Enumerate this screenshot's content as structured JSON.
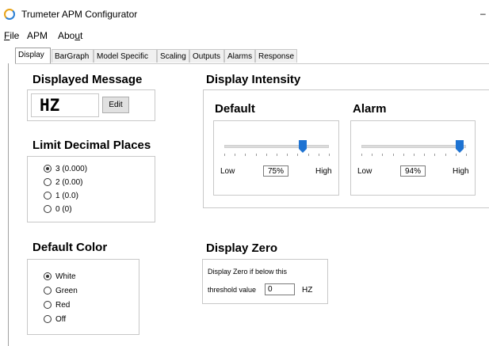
{
  "window": {
    "title": "Trumeter APM Configurator",
    "minimize_glyph": "–"
  },
  "menu": {
    "file": "File",
    "file_ul": "F",
    "file_rest": "ile",
    "apm": "APM",
    "about_pre": "Abo",
    "about_ul": "u",
    "about_post": "t"
  },
  "tabs": [
    "Display",
    "BarGraph",
    "Model Specific",
    "Scaling",
    "Outputs",
    "Alarms",
    "Response"
  ],
  "displayed_message": {
    "heading": "Displayed Message",
    "value": "HZ",
    "edit_label": "Edit"
  },
  "limit_decimal": {
    "heading": "Limit Decimal Places",
    "options": [
      "3 (0.000)",
      "2 (0.00)",
      "1 (0.0)",
      "0 (0)"
    ],
    "selected": 0
  },
  "default_color": {
    "heading": "Default Color",
    "options": [
      "White",
      "Green",
      "Red",
      "Off"
    ],
    "selected": 0
  },
  "intensity": {
    "heading": "Display Intensity",
    "default": {
      "heading": "Default",
      "low": "Low",
      "high": "High",
      "value_text": "75%",
      "value": 0.75
    },
    "alarm": {
      "heading": "Alarm",
      "low": "Low",
      "high": "High",
      "value_text": "94%",
      "value": 0.94
    }
  },
  "display_zero": {
    "heading": "Display Zero",
    "line1": "Display Zero if below this",
    "line2": "threshold value",
    "threshold": "0",
    "unit": "HZ"
  },
  "colors": {
    "accent": "#1e73d2"
  }
}
